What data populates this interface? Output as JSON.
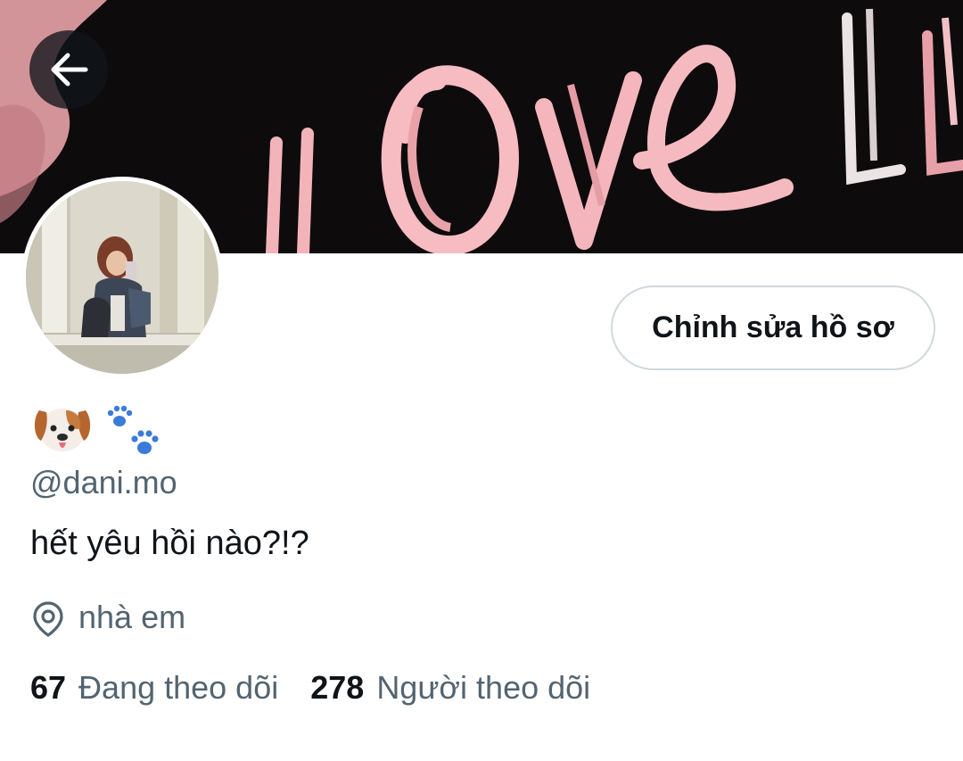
{
  "banner": {
    "text": "LOVE",
    "accent": "#f2a9b0"
  },
  "nav": {
    "back_icon": "arrow-left-icon"
  },
  "profile": {
    "edit_button_label": "Chỉnh sửa hồ sơ",
    "display_name_icons": [
      "dog-face-icon",
      "paw-prints-icon"
    ],
    "handle": "@dani.mo",
    "bio": "hết yêu hồi nào?!?",
    "location": "nhà em",
    "following_count": "67",
    "following_label": "Đang theo dõi",
    "followers_count": "278",
    "followers_label": "Người theo dõi"
  },
  "colors": {
    "text_primary": "#0f1419",
    "text_secondary": "#536471",
    "border": "#cfd9de"
  }
}
